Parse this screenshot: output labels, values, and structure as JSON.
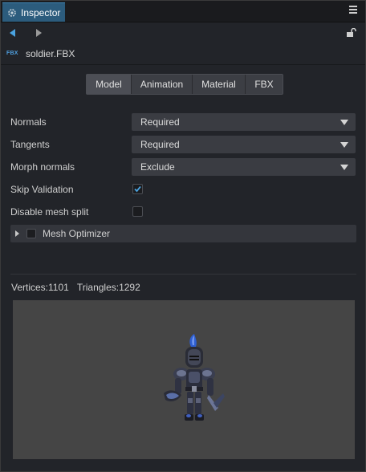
{
  "tab": {
    "title": "Inspector",
    "icon": "gear-icon"
  },
  "file": {
    "type_badge": "FBX",
    "name": "soldier.FBX"
  },
  "segments": [
    {
      "label": "Model",
      "active": true
    },
    {
      "label": "Animation",
      "active": false
    },
    {
      "label": "Material",
      "active": false
    },
    {
      "label": "FBX",
      "active": false
    }
  ],
  "properties": {
    "normals": {
      "label": "Normals",
      "value": "Required"
    },
    "tangents": {
      "label": "Tangents",
      "value": "Required"
    },
    "morph_normals": {
      "label": "Morph normals",
      "value": "Exclude"
    },
    "skip_validation": {
      "label": "Skip Validation",
      "checked": true
    },
    "disable_mesh_split": {
      "label": "Disable mesh split",
      "checked": false
    }
  },
  "mesh_optimizer": {
    "label": "Mesh Optimizer",
    "enabled": false,
    "expanded": false
  },
  "stats": {
    "vertices": "Vertices:1101",
    "triangles": "Triangles:1292"
  },
  "colors": {
    "accent": "#2c5c7d",
    "check": "#4aa3e0",
    "preview_bg": "#454545"
  }
}
